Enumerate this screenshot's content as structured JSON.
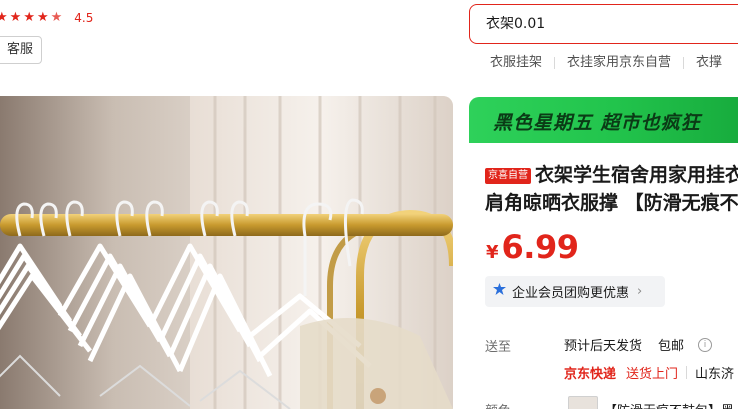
{
  "rating": {
    "value": "4.5",
    "stars": 4.5
  },
  "service": {
    "label": "联系客服",
    "visible_label": "客服"
  },
  "search": {
    "value": "衣架0.01",
    "hot_words": [
      "衣服挂架",
      "衣挂家用京东自营",
      "衣撑"
    ]
  },
  "promo": {
    "text": "黑色星期五 超市也疯狂"
  },
  "product": {
    "badge": "京喜自营",
    "title_line1": "衣架学生宿舍用家用挂衣",
    "title_line2": "肩角晾晒衣服撑 【防滑无痕不",
    "price_symbol": "¥",
    "price": "6.99",
    "enterprise_label": "企业会员团购更优惠"
  },
  "delivery": {
    "label": "送至",
    "ship_time": "预计后天发货",
    "free_shipping": "包邮",
    "carrier": "京东快递",
    "door_delivery": "送货上门",
    "region": "山东济"
  },
  "color": {
    "label": "颜色",
    "variant_text": "【防滑无痕不鼓包】黑"
  },
  "icons": {
    "star": "star-icon",
    "enterprise": "enterprise-icon",
    "chevron": "chevron-right-icon",
    "info": "info-icon"
  },
  "colors": {
    "accent": "#e1251b",
    "promo_green": "#22c44c",
    "enterprise_blue": "#2a6fdb"
  }
}
